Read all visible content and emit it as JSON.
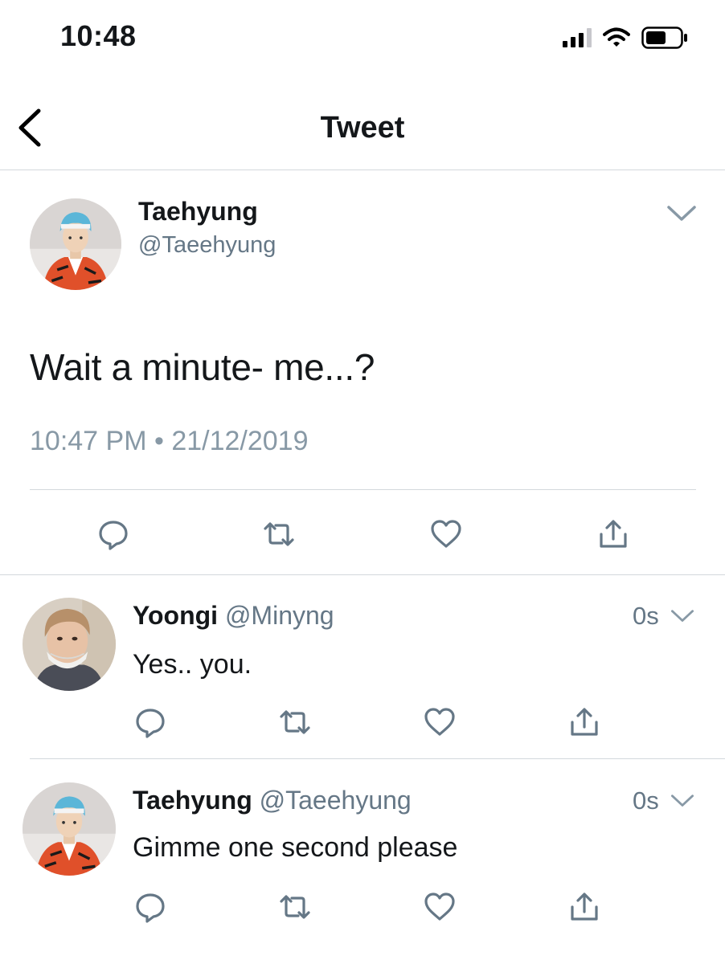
{
  "status_bar": {
    "time": "10:48",
    "icons": [
      "cellular-signal-icon",
      "wifi-icon",
      "battery-icon"
    ]
  },
  "nav": {
    "title": "Tweet",
    "back_icon": "chevron-left-icon"
  },
  "main_tweet": {
    "display_name": "Taehyung",
    "handle": "@Taeehyung",
    "text": "Wait a minute- me...?",
    "timestamp": "10:47 PM • 21/12/2019",
    "actions": [
      "reply-icon",
      "retweet-icon",
      "like-icon",
      "share-icon"
    ]
  },
  "replies": [
    {
      "display_name": "Yoongi",
      "handle": "@Minyng",
      "time": "0s",
      "text": "Yes.. you."
    },
    {
      "display_name": "Taehyung",
      "handle": "@Taeehyung",
      "time": "0s",
      "text": "Gimme one second please"
    }
  ],
  "colors": {
    "text": "#14171a",
    "secondary": "#657786",
    "icon": "#657786",
    "divider": "#d3d8dc"
  }
}
